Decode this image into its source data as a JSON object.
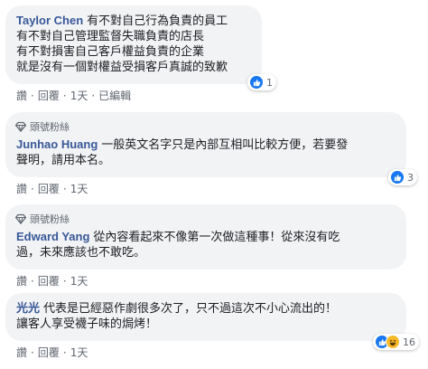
{
  "comments": [
    {
      "author": "Taylor Chen",
      "lines": [
        "有不對自己行為負責的員工",
        "有不對自己管理監督失職負責的店長",
        "有不對損害自己客戶權益負責的企業",
        "就是沒有一個對權益受損客戶真誠的致歉"
      ],
      "actions": {
        "like": "讚",
        "reply": "回覆",
        "time": "1天",
        "edited": "已編輯"
      },
      "reaction_count": "1"
    },
    {
      "badge": "頭號粉絲",
      "author": "Junhao Huang",
      "lines": [
        "一般英文名字只是內部互相叫比較方便，若要發",
        "聲明，請用本名。"
      ],
      "actions": {
        "like": "讚",
        "reply": "回覆",
        "time": "1天"
      },
      "reaction_count": "3"
    },
    {
      "badge": "頭號粉絲",
      "author": "Edward Yang",
      "lines": [
        "從內容看起來不像第一次做這種事！從來沒有吃",
        "過，未來應該也不敢吃。"
      ],
      "actions": {
        "like": "讚",
        "reply": "回覆",
        "time": "1天"
      }
    },
    {
      "author": "光光",
      "lines": [
        "代表是已經惡作劇很多次了，只不過這次不小心流出的！",
        "讓客人享受襪子味的焗烤！"
      ],
      "actions": {
        "like": "讚",
        "reply": "回覆",
        "time": "1天"
      },
      "reaction_count": "16"
    }
  ],
  "colors": {
    "author": "#385898",
    "bubble": "#f2f3f5",
    "meta": "#606770",
    "like": "#1877f2",
    "haha": "#f7b928"
  },
  "icons": {
    "badge": "diamond-badge-icon",
    "like": "thumbs-up-icon",
    "haha": "laughing-face-icon"
  }
}
